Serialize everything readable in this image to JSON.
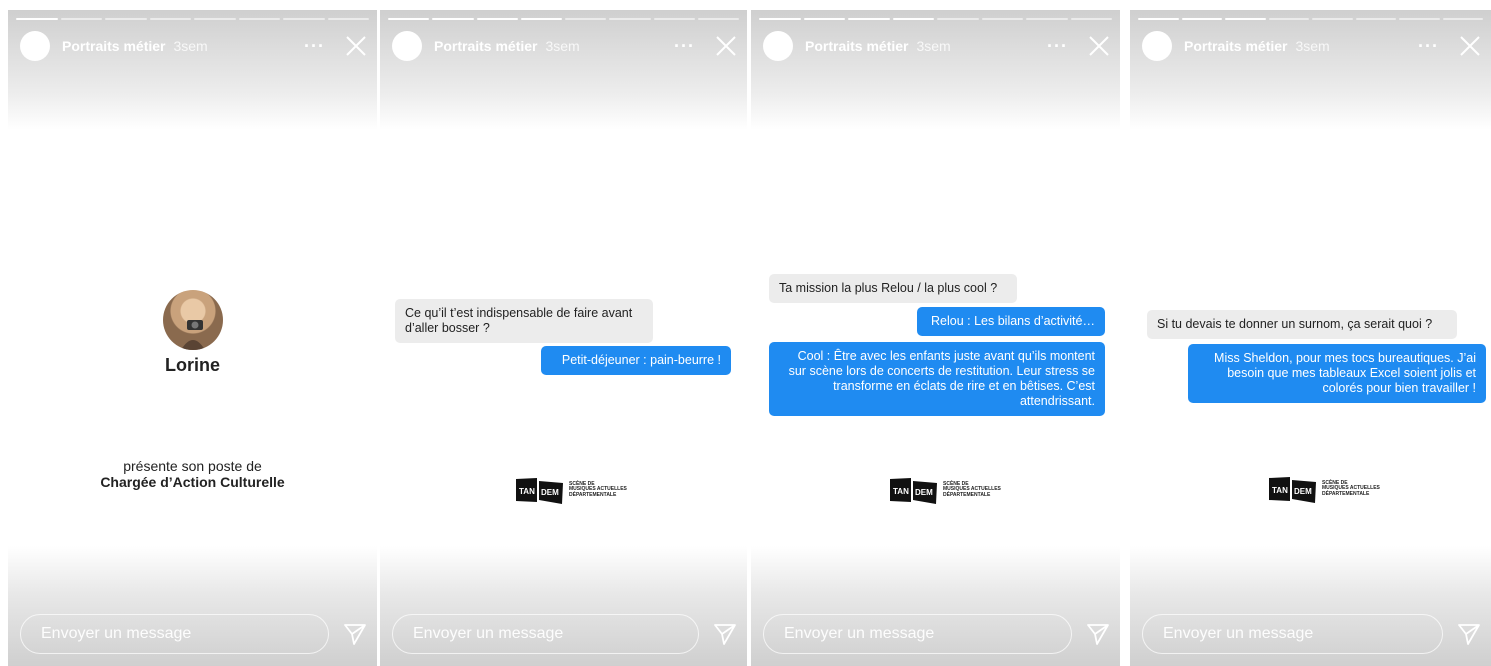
{
  "header": {
    "account": "Portraits métier",
    "time": "3sem",
    "more": "···"
  },
  "footer": {
    "placeholder": "Envoyer un message"
  },
  "story1": {
    "name": "Lorine",
    "intro": "présente son poste de",
    "job": "Chargée d’Action Culturelle"
  },
  "story2": {
    "q1": "Ce qu’il t’est indispensable de faire avant d’aller bosser ?",
    "a1": "Petit-déjeuner : pain-beurre !"
  },
  "story3": {
    "q1": "Ta mission la plus Relou / la plus cool ?",
    "a1": "Relou : Les bilans d’activité…",
    "a2": "Cool : Être avec les enfants juste avant qu’ils montent sur scène lors de concerts de restitution. Leur stress se transforme en éclats de rire et en bêtises. C’est attendrissant."
  },
  "story4": {
    "q1": "Si tu devais te donner un surnom, ça serait quoi ?",
    "a1": "Miss Sheldon, pour mes tocs bureautiques. J’ai besoin que mes tableaux Excel soient jolis et colorés pour bien travailler !"
  },
  "logo": {
    "word1": "TAN",
    "word2": "DEM",
    "line1": "SCÈNE DE",
    "line2": "MUSIQUES ACTUELLES",
    "line3": "DÉPARTEMENTALE"
  }
}
